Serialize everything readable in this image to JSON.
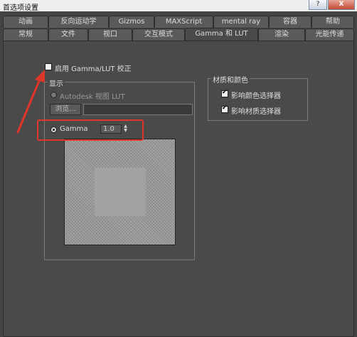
{
  "window": {
    "title": "首选项设置",
    "help_btn": "?",
    "close_btn": "X"
  },
  "tabs_row1": [
    "动画",
    "反向运动学",
    "Gizmos",
    "MAXScript",
    "mental ray",
    "容器",
    "帮助"
  ],
  "tabs_row2": [
    "常规",
    "文件",
    "视口",
    "交互模式",
    "Gamma 和 LUT",
    "渲染",
    "光能传递"
  ],
  "active_tab": "Gamma 和 LUT",
  "enable_gamma": {
    "label": "启用 Gamma/LUT 校正",
    "checked": false
  },
  "display_group": {
    "title": "显示",
    "lut_option": "Autodesk 视图 LUT",
    "browse_button": "浏览...",
    "lut_path": "",
    "gamma_option": "Gamma",
    "gamma_value": "1.0"
  },
  "material_group": {
    "title": "材质和颜色",
    "affect_color_selector": {
      "label": "影响颜色选择器",
      "checked": true
    },
    "affect_material_selector": {
      "label": "影响材质选择器",
      "checked": true
    }
  },
  "annotation_color": "#e0362a"
}
